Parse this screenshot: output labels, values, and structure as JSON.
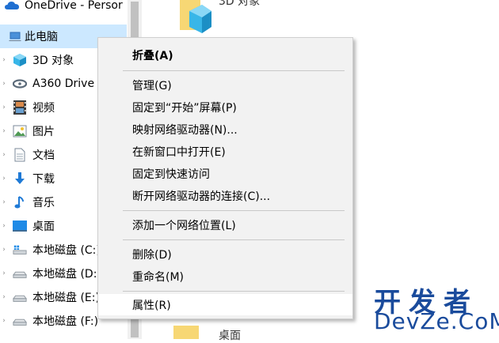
{
  "nav": {
    "items": [
      {
        "label": "OneDrive - Persor",
        "icon": "cloud-icon"
      },
      {
        "label": "此电脑",
        "icon": "this-pc-icon"
      },
      {
        "label": "3D 对象",
        "icon": "3d-objects-icon"
      },
      {
        "label": "A360 Drive",
        "icon": "a360-drive-icon"
      },
      {
        "label": "视频",
        "icon": "video-icon"
      },
      {
        "label": "图片",
        "icon": "pictures-icon"
      },
      {
        "label": "文档",
        "icon": "documents-icon"
      },
      {
        "label": "下载",
        "icon": "download-icon"
      },
      {
        "label": "音乐",
        "icon": "music-icon"
      },
      {
        "label": "桌面",
        "icon": "desktop-icon"
      },
      {
        "label": "本地磁盘 (C:)",
        "icon": "drive-c-icon"
      },
      {
        "label": "本地磁盘 (D:)",
        "icon": "drive-icon"
      },
      {
        "label": "本地磁盘 (E:)",
        "icon": "drive-icon"
      },
      {
        "label": "本地磁盘 (F:)",
        "icon": "drive-icon"
      }
    ]
  },
  "content": {
    "top_item_label": "3D 对象",
    "bottom_item_label": "桌面"
  },
  "menu": {
    "items": [
      {
        "label": "折叠(A)"
      },
      {
        "label": "管理(G)"
      },
      {
        "label": "固定到“开始”屏幕(P)"
      },
      {
        "label": "映射网络驱动器(N)..."
      },
      {
        "label": "在新窗口中打开(E)"
      },
      {
        "label": "固定到快速访问"
      },
      {
        "label": "断开网络驱动器的连接(C)..."
      },
      {
        "label": "添加一个网络位置(L)"
      },
      {
        "label": "删除(D)"
      },
      {
        "label": "重命名(M)"
      },
      {
        "label": "属性(R)"
      }
    ]
  },
  "watermark": {
    "cn": "开发者",
    "en": "DevZe.CoM"
  },
  "colors": {
    "selection": "#cce8ff",
    "menu_background": "#f2f2f2",
    "watermark": "#1a4b9c"
  }
}
